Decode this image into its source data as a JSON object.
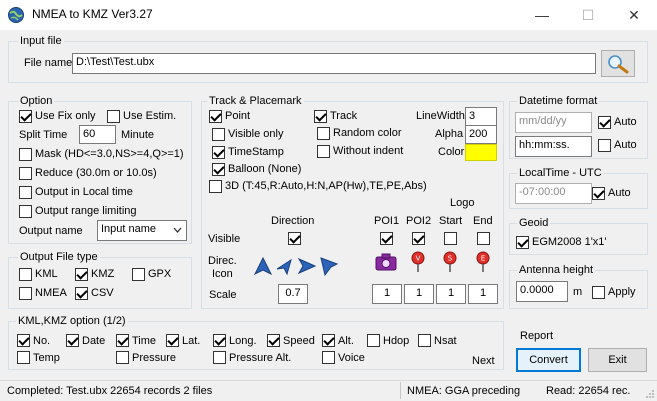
{
  "window": {
    "title": "NMEA to KMZ  Ver3.27",
    "minimize_glyph": "—",
    "maximize_glyph": "☐",
    "close_glyph": "✕"
  },
  "input_file": {
    "group": "Input file",
    "label": "File name",
    "value": "D:\\Test\\Test.ubx"
  },
  "option": {
    "group": "Option",
    "use_fix_only": "Use Fix only",
    "use_estim": "Use Estim.",
    "split_time": "Split Time",
    "split_value": "60",
    "minute": "Minute",
    "mask": "Mask (HD<=3.0,NS>=4,Q>=1)",
    "reduce": "Reduce (30.0m or 10.0s)",
    "output_local": "Output in Local time",
    "output_range": "Output range limiting",
    "output_name": "Output name",
    "output_name_value": "Input name"
  },
  "output_type": {
    "group": "Output File type",
    "kml": "KML",
    "kmz": "KMZ",
    "gpx": "GPX",
    "nmea": "NMEA",
    "csv": "CSV"
  },
  "track": {
    "group": "Track & Placemark",
    "point": "Point",
    "visible_only": "Visible only",
    "timestamp": "TimeStamp",
    "balloon": "Balloon (None)",
    "track": "Track",
    "random_color": "Random color",
    "without_indent": "Without indent",
    "linewidth_label": "LineWidth",
    "linewidth_value": "3",
    "alpha_label": "Alpha",
    "alpha_value": "200",
    "color_label": "Color",
    "color_value": "#ffff00",
    "three_d": "3D (T:45,R:Auto,H:N,AP(Hw),TE,PE,Abs)",
    "logo": "Logo",
    "direction": "Direction",
    "poi1": "POI1",
    "poi2": "POI2",
    "start": "Start",
    "end": "End",
    "visible": "Visible",
    "direc_icon_1": "Direc.",
    "direc_icon_2": "Icon",
    "scale": "Scale",
    "scale_direction": "0.7",
    "scale_poi1": "1",
    "scale_poi2": "1",
    "scale_start": "1",
    "scale_end": "1",
    "pin_v": "V",
    "pin_s": "S",
    "pin_e": "E"
  },
  "datetime": {
    "group": "Datetime format",
    "date_placeholder": "mm/dd/yy",
    "time_value": "hh:mm:ss.",
    "auto": "Auto"
  },
  "localtime": {
    "group": "LocalTime - UTC",
    "value": "-07:00:00",
    "auto": "Auto"
  },
  "geoid": {
    "group": "Geoid",
    "egm": "EGM2008  1'x1'"
  },
  "antenna": {
    "group": "Antenna height",
    "value": "0.0000",
    "unit": "m",
    "apply": "Apply"
  },
  "kml_option": {
    "group": "KML,KMZ option (1/2)",
    "no": "No.",
    "date": "Date",
    "time": "Time",
    "lat": "Lat.",
    "long": "Long.",
    "speed": "Speed",
    "alt": "Alt.",
    "hdop": "Hdop",
    "nsat": "Nsat",
    "temp": "Temp",
    "pressure": "Pressure",
    "pressure_alt": "Pressure Alt.",
    "voice": "Voice",
    "next": "Next"
  },
  "actions": {
    "report": "Report",
    "convert": "Convert",
    "exit": "Exit"
  },
  "status": {
    "left": "Completed: Test.ubx  22654 records  2 files",
    "mid": "NMEA: GGA preceding",
    "right": "Read: 22654 rec."
  }
}
